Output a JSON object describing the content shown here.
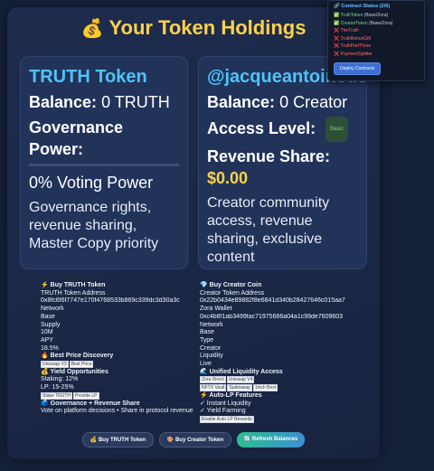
{
  "header": {
    "icon": "money-bag-icon",
    "title": "Your Token Holdings",
    "glyph": "💰"
  },
  "truth_card": {
    "title": "TRUTH Token",
    "balance_label": "Balance:",
    "balance_value": "0 TRUTH",
    "governance_label": "Governance Power:",
    "voting_power": "0% Voting Power",
    "description": "Governance rights, revenue sharing, Master Copy priority"
  },
  "creator_card": {
    "title": "@jacqueantoinedegraff",
    "balance_label": "Balance:",
    "balance_value": "0 Creator",
    "access_label": "Access Level:",
    "access_badge": "Basic",
    "revenue_label": "Revenue Share:",
    "revenue_value": "$0.00",
    "description": "Creator community access, revenue sharing, exclusive content"
  },
  "truth_info": {
    "heading": "⚡ Buy TRUTH Token",
    "address_label": "TRUTH Token Address",
    "address": "0x8fc6f6f7747e170f4768533b869c339dc3d30a3c",
    "network_label": "Network",
    "network": "Base",
    "supply_label": "Supply",
    "supply": "10M",
    "apy_label": "APY",
    "apy": "18.5%",
    "best_price_heading": "🔥 Best Price Discovery",
    "best_price_tags": [
      "Uniswap V3",
      "Best Price"
    ],
    "yield_heading": "💰 Yield Opportunities",
    "staking": "Staking: 12%",
    "lp": "LP: 15-25%",
    "yield_tags": [
      "Stake TRUTH",
      "Provide LP"
    ],
    "gov_heading": "🗳️ Governance + Revenue Share",
    "gov_text": "Vote on platform decisions • Share in protocol revenue"
  },
  "creator_info": {
    "heading": "💎 Buy Creator Coin",
    "address_label": "Creator Token Address",
    "address": "0x22b0434e89882f8e6841d340b28427646c015aa7",
    "zora_label": "Zora Wallet",
    "zora": "0xc4b8f1ab3499fac71975666a04a1c99de7609603",
    "network_label": "Network",
    "network": "Base",
    "type_label": "Type",
    "type": "Creator",
    "liquidity_label": "Liquidity",
    "liquidity": "Live",
    "unified_heading": "🌊 Unified Liquidity Access",
    "unified_tags": [
      "Zora Direct",
      "Uniswap V4",
      "NFTX Vault",
      "Sudoswap",
      "1inch Best"
    ],
    "autolp_heading": "⚡ Auto-LP Features",
    "autolp_1": "✓ Instant Liquidity",
    "autolp_2": "✓ Yield Farming",
    "autolp_tag": "Enable Auto-LP Rewards"
  },
  "buttons": {
    "buy_truth": "💰 Buy TRUTH Token",
    "buy_creator": "🎨 Buy Creator Token",
    "refresh": "🔄 Refresh Balances"
  },
  "contract_popup": {
    "title": "🔗 Contract Status (2/6)",
    "items": [
      {
        "mark": "✅",
        "name": "TruthToken",
        "note": "(Base/Zora)",
        "ok": true
      },
      {
        "mark": "✅",
        "name": "CreatorToken",
        "note": "(Base/Zora)",
        "ok": true
      },
      {
        "mark": "❌",
        "name": "TheTruth",
        "note": "",
        "ok": false
      },
      {
        "mark": "❌",
        "name": "TruthBonusGift",
        "note": "",
        "ok": false
      },
      {
        "mark": "❌",
        "name": "TruthPartThree",
        "note": "",
        "ok": false
      },
      {
        "mark": "❌",
        "name": "PaymentSplitter",
        "note": "",
        "ok": false
      }
    ],
    "deploy_label": "Deploy Contracts"
  }
}
